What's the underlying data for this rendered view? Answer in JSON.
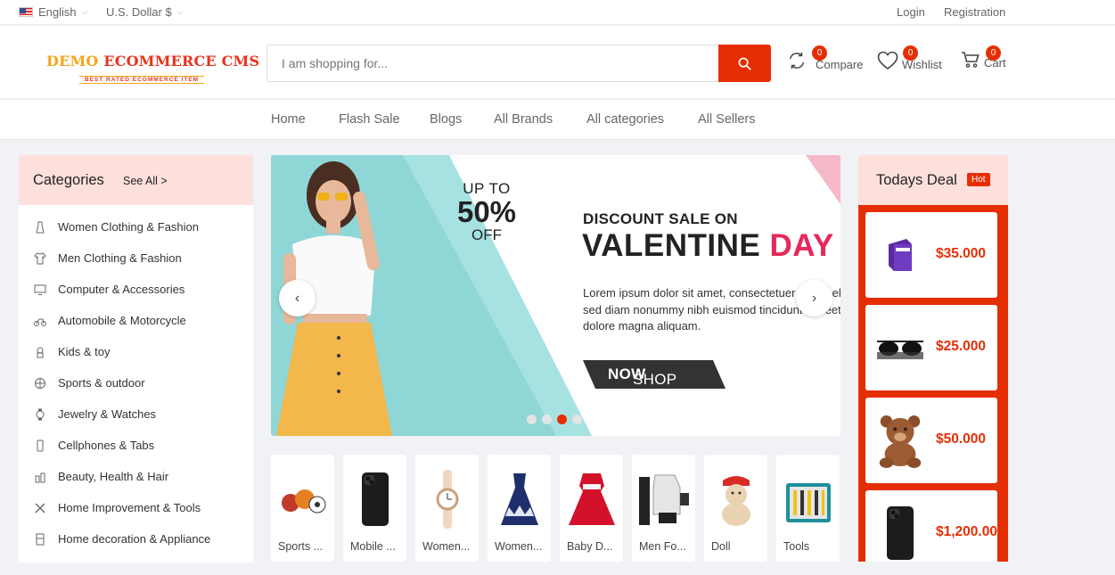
{
  "topbar": {
    "language": "English",
    "currency": "U.S. Dollar $",
    "login": "Login",
    "registration": "Registration"
  },
  "logo": {
    "brand_a": "DEMO",
    "brand_b": "ECOMMERCE CMS",
    "tagline": "BEST RATED ECOMMERCE ITEM"
  },
  "search": {
    "placeholder": "I am shopping for..."
  },
  "header_actions": {
    "compare": {
      "label": "Compare",
      "count": "0"
    },
    "wishlist": {
      "label": "Wishlist",
      "count": "0"
    },
    "cart": {
      "label": "Cart",
      "count": "0"
    }
  },
  "nav": [
    "Home",
    "Flash Sale",
    "Blogs",
    "All Brands",
    "All categories",
    "All Sellers"
  ],
  "categories": {
    "title": "Categories",
    "see_all": "See All >",
    "items": [
      {
        "label": "Women Clothing & Fashion",
        "icon": "dress-icon"
      },
      {
        "label": "Men Clothing & Fashion",
        "icon": "shirt-icon"
      },
      {
        "label": "Computer & Accessories",
        "icon": "monitor-icon"
      },
      {
        "label": "Automobile & Motorcycle",
        "icon": "motorcycle-icon"
      },
      {
        "label": "Kids & toy",
        "icon": "toy-icon"
      },
      {
        "label": "Sports & outdoor",
        "icon": "sports-icon"
      },
      {
        "label": "Jewelry & Watches",
        "icon": "watch-icon"
      },
      {
        "label": "Cellphones & Tabs",
        "icon": "phone-icon"
      },
      {
        "label": "Beauty, Health & Hair",
        "icon": "beauty-icon"
      },
      {
        "label": "Home Improvement & Tools",
        "icon": "tools-icon"
      },
      {
        "label": "Home decoration & Appliance",
        "icon": "appliance-icon"
      }
    ]
  },
  "banner": {
    "up_to": "UP TO",
    "percent": "50%",
    "off": "OFF",
    "discount": "DISCOUNT SALE ON",
    "valentine_a": "VALENTINE",
    "valentine_b": "DAY",
    "lorem": "Lorem ipsum dolor sit amet, consectetuer adipis elit, sed diam nonummy nibh euismod tincidunt laoreet dolore magna aliquam.",
    "shop_a": "SHOP",
    "shop_b": "NOW",
    "prev": "‹",
    "next": "›",
    "slides": 4,
    "active_slide": 3,
    "colors": {
      "teal": "#8fd6d7",
      "pink": "#e6285a",
      "accent": "#e62e04"
    }
  },
  "products": [
    {
      "name": "Sports ...",
      "icon": "sports-balls-icon"
    },
    {
      "name": "Mobile ...",
      "icon": "smartphone-icon"
    },
    {
      "name": "Women...",
      "icon": "wristwatch-icon"
    },
    {
      "name": "Women...",
      "icon": "dress-icon"
    },
    {
      "name": "Baby D...",
      "icon": "baby-dress-icon"
    },
    {
      "name": "Men Fo...",
      "icon": "men-outfit-icon"
    },
    {
      "name": "Doll",
      "icon": "teddy-doll-icon"
    },
    {
      "name": "Tools",
      "icon": "toolbox-icon"
    }
  ],
  "todays_deal": {
    "title": "Todays Deal",
    "badge": "Hot",
    "items": [
      {
        "price": "$35.000",
        "icon": "software-box-icon"
      },
      {
        "price": "$25.000",
        "icon": "sunglasses-icon"
      },
      {
        "price": "$50.000",
        "icon": "teddy-bear-icon"
      },
      {
        "price": "$1,200.00",
        "icon": "smartphone-icon"
      }
    ]
  }
}
